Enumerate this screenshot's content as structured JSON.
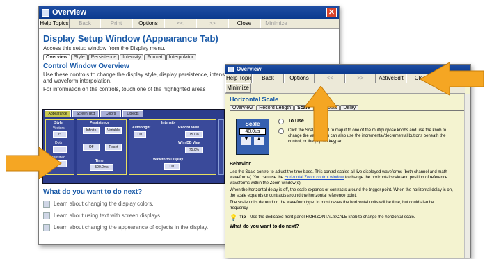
{
  "back_window": {
    "title": "Overview",
    "toolbar": [
      "Help Topics",
      "Back",
      "Print",
      "Options",
      "<<",
      ">>",
      "Close",
      "Minimize"
    ],
    "heading": "Display Setup Window (Appearance Tab)",
    "access_text": "Access this setup window from the Display menu.",
    "tabs": [
      "Overview",
      "Style",
      "Persistence",
      "Intensity",
      "Format",
      "Interpolator"
    ],
    "section_title": "Control Window Overview",
    "para1": "Use these controls to change the display style, display persistence, intensity, format,",
    "para1b": "and waveform interpolation.",
    "para2": "For information on the controls, touch one of the highlighted areas",
    "panel": {
      "tabs": [
        "Appearance",
        "Screen Text",
        "Colors",
        "Objects"
      ],
      "style_label": "Style",
      "style_sub": [
        "Vectors",
        "Dots",
        "Intensified"
      ],
      "persistence_label": "Persistence",
      "persistence_buttons": [
        "Infinite",
        "Variable",
        "Off",
        "Reset"
      ],
      "time_label": "Time",
      "time_value": "500.0ms",
      "intensity_label": "Intensity",
      "autobright_label": "AutoBright",
      "record_view_label": "Record View",
      "on_label": "On",
      "record_value": "75.0%",
      "wfm_db_label": "Wfm DB View",
      "wfm_db_value": "75.0%",
      "waveform_display_label": "Waveform Display",
      "waveform_display_value": "On"
    },
    "next_heading": "What do you want to do next?",
    "next_items": [
      "Learn about changing the display colors.",
      "Learn about using text with screen displays.",
      "Learn about changing the appearance of objects in the display."
    ]
  },
  "front_window": {
    "title": "Overview",
    "toolbar_row1": [
      "Help Topics",
      "Back",
      "Options",
      "<<",
      ">>",
      "ActiveEdit",
      "Close"
    ],
    "toolbar_row2": [
      "Minimize"
    ],
    "heading": "Horizontal Scale",
    "tabs": [
      "Overview",
      "Record Length",
      "Scale",
      "Readouts",
      "Delay"
    ],
    "scale_label": "Scale",
    "scale_value": "40.0us",
    "to_use_label": "To Use",
    "to_use_text": "Click the Scale control to map it to one of the multipurpose knobs and use the knob to change the value. You can also use the incremental/decremental buttons beneath the control, or the pop-up keypad.",
    "behavior_heading": "Behavior",
    "behavior_p1a": "Use the Scale control to adjust the time base. This control scales all live displayed waveforms (both channel and math waveforms). You can use the ",
    "behavior_link": "Horizontal Zoom control window",
    "behavior_p1b": " to change the horizontal scale and position of reference waveforms within the Zoom window(s).",
    "behavior_p2": "When the horizontal delay is off, the scale expands or contracts around the trigger point. When the horizontal delay is on, the scale expands or contracts around the horizontal reference point.",
    "behavior_p3": "The scale units depend on the waveform type. In most cases the horizontal units will be time, but could also be frequency.",
    "tip_label": "Tip",
    "tip_text": "Use the dedicated front-panel HORIZONTAL SCALE knob to change the horizontal scale.",
    "next_heading": "What do you want to do next?"
  },
  "colors": {
    "titlebar": "#0b3a8e",
    "heading": "#1a5aa8",
    "front_bg": "#f4f3d0",
    "arrow": "#f5a623",
    "panel": "#2c3c8c"
  }
}
